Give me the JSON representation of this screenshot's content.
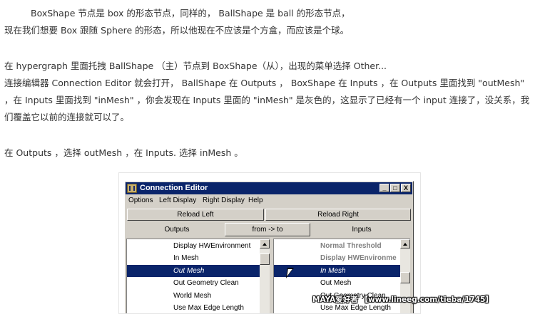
{
  "article": {
    "p1_line1": "BoxShape 节点是 box 的形态节点，同样的， BallShape 是 ball 的形态节点，",
    "p1_line2": "现在我们想要 Box 跟随 Sphere 的形态，所以他现在不应该是个方盒，而应该是个球。",
    "p2_line1": "在 hypergraph 里面托拽 BallShape （主）节点到 BoxShape（从），出现的菜单选择 Other...",
    "p2_line2": "连接编辑器 Connection Editor 就会打开， BallShape 在 Outputs ， BoxShape 在 Inputs ，在 Outputs 里面找到 \"outMesh\"",
    "p2_line3": "，在 Inputs 里面找到 \"inMesh\" ，你会发现在 Inputs 里面的 \"inMesh\" 是灰色的，这显示了已经有一个 input 连接了，没关系，我",
    "p2_line4": "们覆盖它以前的连接就可以了。",
    "p3_line1": "在 Outputs ，选择 outMesh ，在 Inputs. 选择 inMesh 。"
  },
  "window": {
    "title": "Connection Editor",
    "controls": {
      "minimize": "_",
      "maximize": "□",
      "close": "X"
    },
    "menu": [
      "Options",
      "Left Display",
      "Right Display",
      "Help"
    ],
    "reload_left": "Reload Left",
    "reload_right": "Reload Right",
    "outputs_label": "Outputs",
    "direction_button": "from -> to",
    "inputs_label": "Inputs",
    "left_list": [
      "Display HWEnvironment",
      "In Mesh",
      "Out Mesh",
      "Out Geometry Clean",
      "World Mesh",
      "Use Max Edge Length"
    ],
    "right_list": [
      "Normal Threshold",
      "Display HWEnvironme",
      "In Mesh",
      "Out Mesh",
      "Out Geometry Clean",
      "Use Max Edge Length"
    ]
  },
  "watermark": "MAYA爱好者 【www.lineeg.com/tieba/1745】",
  "colors": {
    "selection": "#0a246a",
    "window_bg": "#d4d0c8",
    "text": "#333333"
  }
}
